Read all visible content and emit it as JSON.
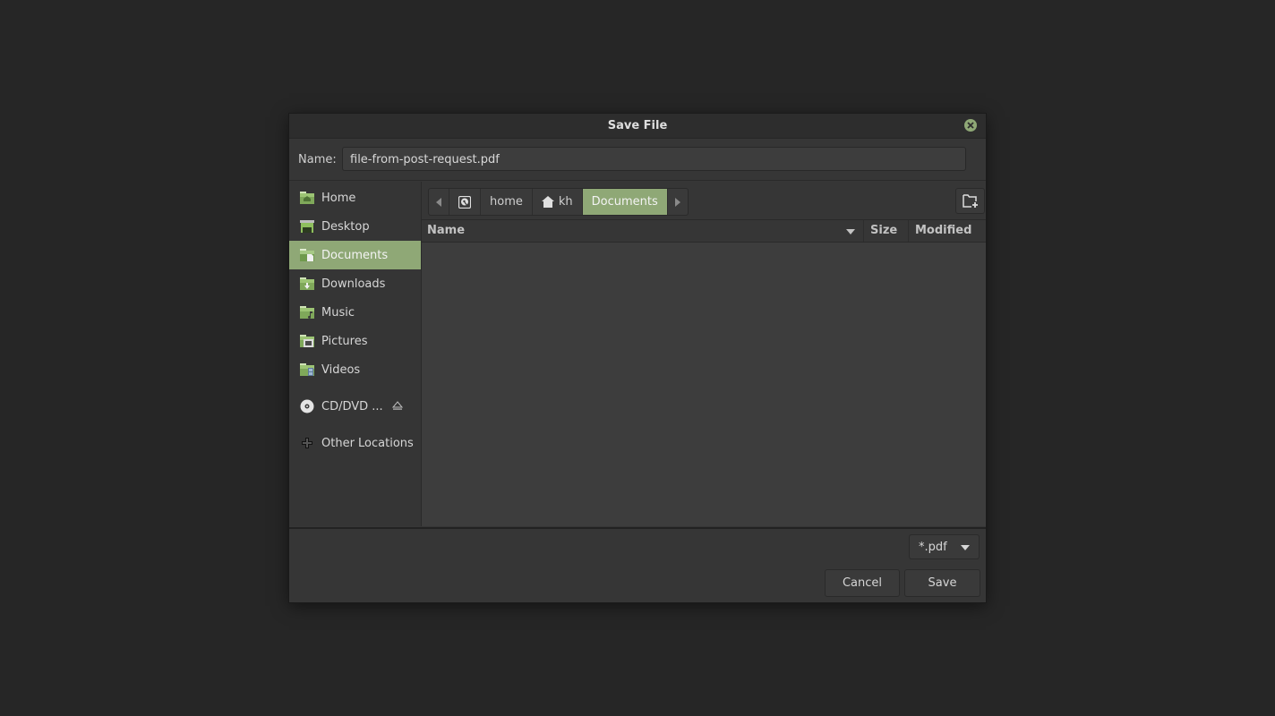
{
  "dialog": {
    "title": "Save File",
    "close_icon": "close-icon"
  },
  "name_field": {
    "label": "Name:",
    "value": "file-from-post-request.pdf"
  },
  "sidebar": {
    "items": [
      {
        "label": "Home",
        "icon": "folder-home-icon"
      },
      {
        "label": "Desktop",
        "icon": "desktop-icon"
      },
      {
        "label": "Documents",
        "icon": "folder-documents-icon",
        "active": true
      },
      {
        "label": "Downloads",
        "icon": "folder-download-icon"
      },
      {
        "label": "Music",
        "icon": "folder-music-icon"
      },
      {
        "label": "Pictures",
        "icon": "folder-pictures-icon"
      },
      {
        "label": "Videos",
        "icon": "folder-videos-icon"
      },
      {
        "label": "CD/DVD ...",
        "icon": "optical-disc-icon",
        "eject_icon": "eject-icon"
      },
      {
        "label": "Other Locations",
        "icon": "plus-icon"
      }
    ]
  },
  "pathbar": {
    "crumbs": [
      "home",
      "kh",
      "Documents"
    ],
    "active": "Documents"
  },
  "columns": {
    "name": "Name",
    "size": "Size",
    "modified": "Modified"
  },
  "files": [],
  "filter": {
    "selected": "*.pdf"
  },
  "buttons": {
    "cancel": "Cancel",
    "save": "Save"
  },
  "colors": {
    "accent": "#8fa876",
    "background": "#262626",
    "dialog": "#363636",
    "list": "#3d3d3d"
  }
}
